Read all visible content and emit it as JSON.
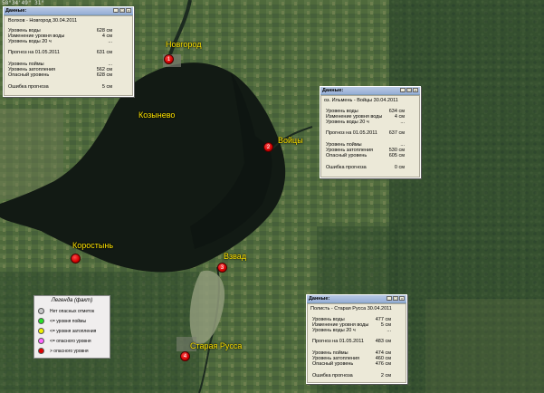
{
  "coord_readout": "58°34'49\" 31°",
  "labels": {
    "novgorod": "Новгород",
    "kozynevo": "Козынево",
    "voishchi": "Войцы",
    "korostyn": "Коростынь",
    "vzvad": "Взвад",
    "staraya_russa": "Старая Русса"
  },
  "markers": {
    "novgorod": "1",
    "voishchi": "2",
    "korostyn": "",
    "vzvad": "3",
    "staraya_russa": "4"
  },
  "popup1": {
    "title": "Данные:",
    "station": "Волхов - Новгород  30.04.2011",
    "rows": [
      {
        "label": "Уровень воды",
        "value": "628  см"
      },
      {
        "label": "Изменение уровня воды",
        "value": "4  см"
      },
      {
        "label": "Уровень воды 20 ч",
        "value": "..."
      },
      {
        "label": "Прогноз на 01.05.2011",
        "value": "631  см"
      },
      {
        "label": "Уровень поймы",
        "value": "..."
      },
      {
        "label": "Уровень затопления",
        "value": "562  см"
      },
      {
        "label": "Опасный уровень",
        "value": "628  см"
      },
      {
        "label": "Ошибка прогноза",
        "value": "5  см"
      }
    ]
  },
  "popup2": {
    "title": "Данные:",
    "station": "оз. Ильмень - Войцы  30.04.2011",
    "rows": [
      {
        "label": "Уровень воды",
        "value": "634  см"
      },
      {
        "label": "Изменение уровня воды",
        "value": "4  см"
      },
      {
        "label": "Уровень воды 20 ч",
        "value": "..."
      },
      {
        "label": "Прогноз на 01.05.2011",
        "value": "637  см"
      },
      {
        "label": "Уровень поймы",
        "value": "..."
      },
      {
        "label": "Уровень затопления",
        "value": "530  см"
      },
      {
        "label": "Опасный уровень",
        "value": "605  см"
      },
      {
        "label": "Ошибка прогноза",
        "value": "0  см"
      }
    ]
  },
  "popup3": {
    "title": "Данные:",
    "station": "Полисть - Старая Русса  30.04.2011",
    "rows": [
      {
        "label": "Уровень воды",
        "value": "477  см"
      },
      {
        "label": "Изменение уровня воды",
        "value": "5  см"
      },
      {
        "label": "Уровень воды 20 ч",
        "value": "..."
      },
      {
        "label": "Прогноз на 01.05.2011",
        "value": "483  см"
      },
      {
        "label": "Уровень поймы",
        "value": "474  см"
      },
      {
        "label": "Уровень затопления",
        "value": "460  см"
      },
      {
        "label": "Опасный уровень",
        "value": "476  см"
      },
      {
        "label": "Ошибка прогноза",
        "value": "2  см"
      }
    ]
  },
  "legend": {
    "title": "Легенда (факт)",
    "items": [
      {
        "text": "Нет опасных отметок",
        "color": "#c8c8c8"
      },
      {
        "text": "<= уровня поймы",
        "color": "#28e028"
      },
      {
        "text": "<= уровня затопления",
        "color": "#f0f000"
      },
      {
        "text": "<= опасного уровня",
        "color": "#ff66ff"
      },
      {
        "text": "> опасного уровня",
        "color": "#e00000"
      }
    ]
  }
}
